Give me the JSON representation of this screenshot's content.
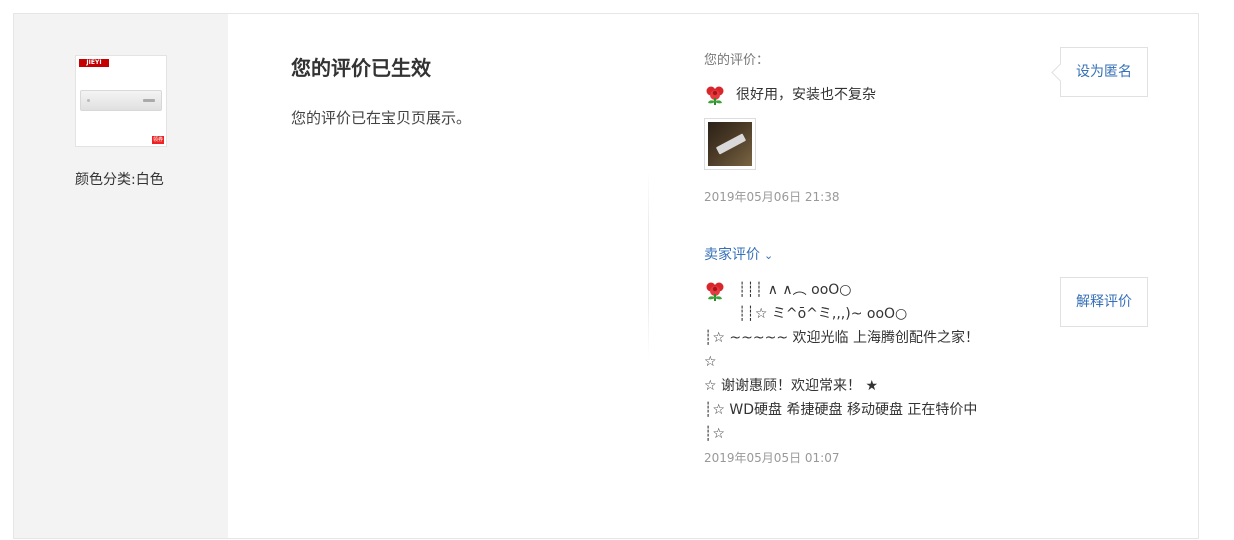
{
  "product": {
    "sku_label": "颜色分类:白色",
    "thumb_brand": "JIEYI",
    "thumb_tag": "领券"
  },
  "status": {
    "title": "您的评价已生效",
    "description": "您的评价已在宝贝页展示。"
  },
  "buyer_review": {
    "label": "您的评价：",
    "text": "很好用，安装也不复杂",
    "date": "2019年05月06日 21:38"
  },
  "seller_review": {
    "toggle_label": "卖家评价",
    "lines": [
      "┊┊┊ ∧ ∧︵ ooO○",
      "┊┊☆ ミ^ō^ミ,,,)~ ooO○",
      "┊☆ ~~~~~ 欢迎光临 上海腾创配件之家！",
      "☆",
      "☆ 谢谢惠顾！欢迎常来！ ★",
      "┊☆ WD硬盘 希捷硬盘 移动硬盘 正在特价中",
      "┊☆"
    ],
    "date": "2019年05月05日 01:07"
  },
  "buttons": {
    "anonymous": "设为匿名",
    "explain": "解释评价"
  },
  "icons": {
    "flower": "rose-icon",
    "chevron": "chevron-down-icon"
  },
  "colors": {
    "link": "#3670b8",
    "left_panel_bg": "#f3f3f3"
  }
}
